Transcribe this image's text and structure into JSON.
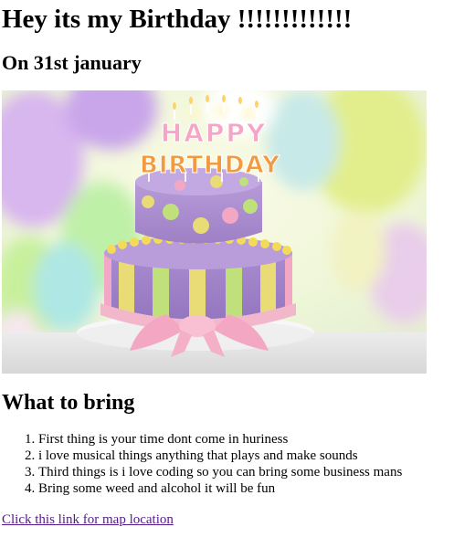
{
  "heading": "Hey its my Birthday !!!!!!!!!!!!!",
  "date_heading": "On 31st january",
  "image": {
    "cake_sign_top": "HAPPY",
    "cake_sign_bottom": "BIRTHDAY"
  },
  "bring_heading": "What to bring",
  "bring_items": [
    "First thing is your time dont come in huriness",
    "i love musical things anything that plays and make sounds",
    "Third things is i love coding so you can bring some business mans",
    "Bring some weed and alcohol it will be fun"
  ],
  "map_link": "Click this link for map location",
  "colors": {
    "visited_link": "#551a8b"
  }
}
